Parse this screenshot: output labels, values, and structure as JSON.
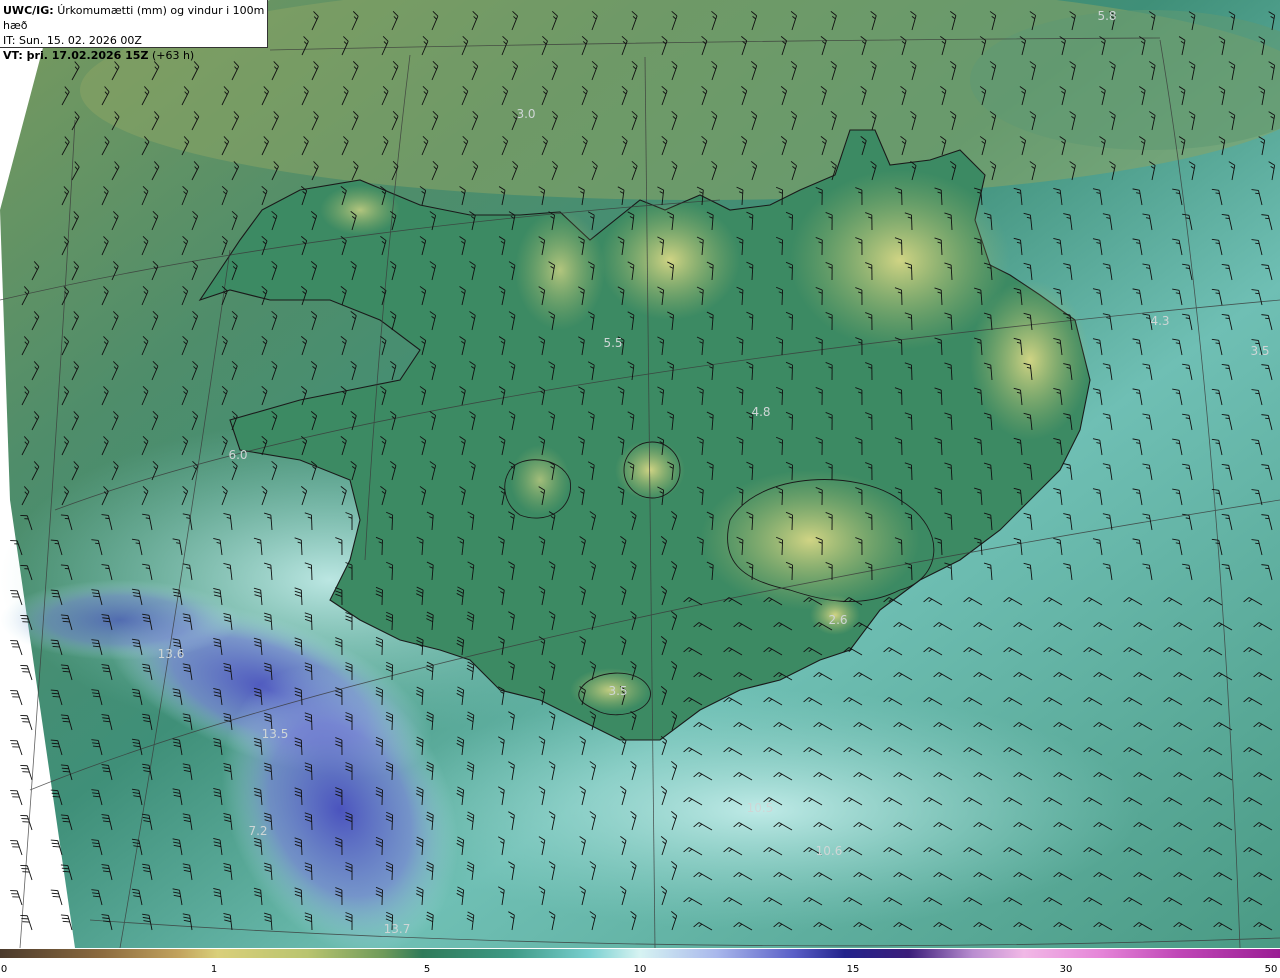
{
  "header": {
    "product": "UWC/IG:",
    "title": "Úrkomumætti (mm) og vindur i 100m hæð",
    "init_time": "IT: Sun. 15. 02. 2026 00Z",
    "valid_prefix": "VT: þri. 17.02.2026 15Z",
    "valid_suffix": "(+63 h)"
  },
  "map_labels": [
    "5.8",
    "3.0",
    "4.3",
    "3.5",
    "5.5",
    "4.8",
    "6.0",
    "2.6",
    "13.6",
    "13.5",
    "3.5",
    "7.2",
    "10.5",
    "10.6",
    "13.7"
  ],
  "colorbar": {
    "ticks": [
      "0",
      "1",
      "5",
      "10",
      "15",
      "30",
      "50"
    ],
    "colors": [
      "#4b3a2c",
      "#d9cf7a",
      "#2f7b5a",
      "#d6f3f2",
      "#23238c",
      "#f1b8e6",
      "#9a1e94"
    ]
  }
}
